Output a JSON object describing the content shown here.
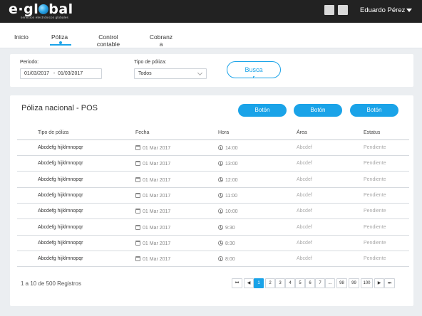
{
  "header": {
    "logo": "e·global",
    "logo_sub": "servicios electrónicos globales",
    "user": "Eduardo Pérez"
  },
  "nav": {
    "items": [
      {
        "label": "Inicio"
      },
      {
        "label": "Póliza"
      },
      {
        "label": "Control contable"
      },
      {
        "label": "Cobranza"
      }
    ],
    "active": "Póliza"
  },
  "filters": {
    "period_label": "Periodo:",
    "period_value": "01/03/2017   -  01/03/2017",
    "type_label": "Tipo de póliza:",
    "type_value": "Todos",
    "search_label": "Busca r"
  },
  "table": {
    "title": "Póliza nacional - POS",
    "buttons": [
      "Botón",
      "Botón",
      "Botón"
    ],
    "headers": [
      "Tipo de póliza",
      "Fecha",
      "Hora",
      "Área",
      "Estatus"
    ],
    "rows": [
      {
        "type": "Abcdefg hijklmnopqr",
        "date": "01 Mar 2017",
        "time": "14:00",
        "area": "Abcdef",
        "status": "Pendiente"
      },
      {
        "type": "Abcdefg hijklmnopqr",
        "date": "01 Mar 2017",
        "time": "13:00",
        "area": "Abcdef",
        "status": "Pendiente"
      },
      {
        "type": "Abcdefg hijklmnopqr",
        "date": "01 Mar 2017",
        "time": "12:00",
        "area": "Abcdef",
        "status": "Pendiente"
      },
      {
        "type": "Abcdefg hijklmnopqr",
        "date": "01 Mar 2017",
        "time": "11:00",
        "area": "Abcdef",
        "status": "Pendiente"
      },
      {
        "type": "Abcdefg hijklmnopqr",
        "date": "01 Mar 2017",
        "time": "10:00",
        "area": "Abcdef",
        "status": "Pendiente"
      },
      {
        "type": "Abcdefg hijklmnopqr",
        "date": "01 Mar 2017",
        "time": "9:30",
        "area": "Abcdef",
        "status": "Pendiente"
      },
      {
        "type": "Abcdefg hijklmnopqr",
        "date": "01 Mar 2017",
        "time": "8:30",
        "area": "Abcdef",
        "status": "Pendiente"
      },
      {
        "type": "Abcdefg hijklmnopqr",
        "date": "01 Mar 2017",
        "time": "8:00",
        "area": "Abcdef",
        "status": "Pendiente"
      }
    ],
    "records_text": "1 a 10  de  500  Registros",
    "pagination": [
      "⏮",
      "◀",
      "1",
      "2",
      "3",
      "4",
      "5",
      "6",
      "7",
      "...",
      "98",
      "99",
      "100",
      "▶",
      "⏭"
    ],
    "current_page": "1"
  },
  "colors": {
    "accent": "#1aa3e8",
    "topbar": "#222222",
    "background": "#ebeef1"
  }
}
